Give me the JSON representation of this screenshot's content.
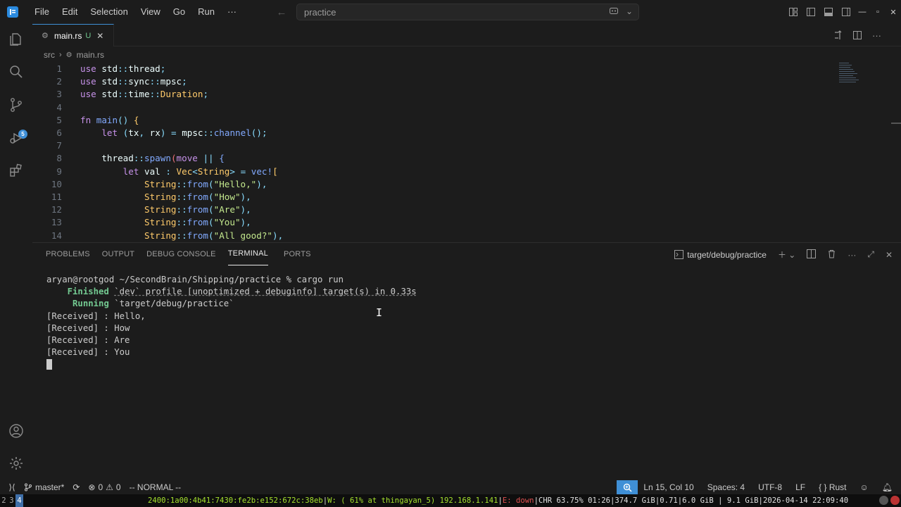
{
  "titlebar": {
    "menu": [
      "File",
      "Edit",
      "Selection",
      "View",
      "Go",
      "Run",
      "···"
    ],
    "search_text": "practice"
  },
  "activitybar": {
    "scm_badge": "5"
  },
  "editor": {
    "tab": {
      "label": "main.rs",
      "status": "U"
    },
    "breadcrumb": [
      "src",
      "main.rs"
    ],
    "line_numbers": [
      "1",
      "2",
      "3",
      "4",
      "5",
      "6",
      "7",
      "8",
      "9",
      "10",
      "11",
      "12",
      "13",
      "14"
    ]
  },
  "panel": {
    "tabs": [
      "PROBLEMS",
      "OUTPUT",
      "DEBUG CONSOLE",
      "TERMINAL",
      "PORTS"
    ],
    "active_tab": "TERMINAL",
    "terminal_name": "target/debug/practice",
    "terminal": {
      "prompt_user": "aryan@rootgod",
      "prompt_path": "~/SecondBrain/Shipping/practice",
      "prompt_symbol": "%",
      "command": "cargo run",
      "finished_label": "Finished",
      "finished_text": "`dev` profile [unoptimized + debuginfo] target(s) in 0.33s",
      "running_label": "Running",
      "running_text": "`target/debug/practice`",
      "output": [
        "[Received] : Hello,",
        "[Received] : How",
        "[Received] : Are",
        "[Received] : You"
      ]
    }
  },
  "statusbar": {
    "branch": "master*",
    "errors": "0",
    "warnings": "0",
    "vim_mode": "-- NORMAL --",
    "position": "Ln 15, Col 10",
    "spaces": "Spaces: 4",
    "encoding": "UTF-8",
    "eol": "LF",
    "language": "Rust"
  },
  "systembar": {
    "workspaces": [
      "2",
      "3",
      "4"
    ],
    "active_workspace": "4",
    "ipv6": "2400:1a00:4b41:7430:fe2b:e152:672c:38eb",
    "wifi": "W: ( 61% at thingayan_5) 192.168.1.141",
    "eth": "E: down",
    "battery": "CHR 63.75% 01:26",
    "disk": "374.7 GiB",
    "load": "0.71",
    "memory": "6.0 GiB | 9.1 GiB",
    "datetime": "2026-04-14 22:09:40"
  },
  "colors": {
    "accent": "#3f8fd6",
    "background": "#1c1c1c",
    "success": "#73c991"
  }
}
